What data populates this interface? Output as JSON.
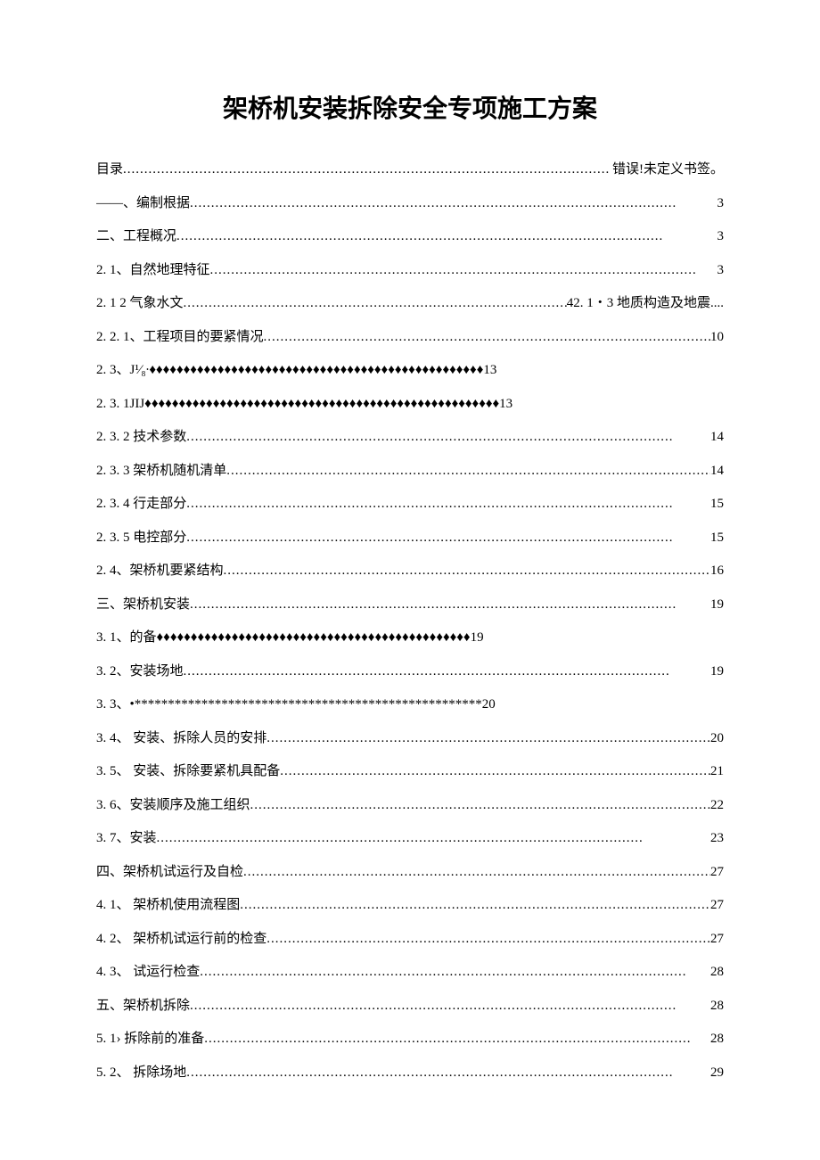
{
  "title": "架桥机安装拆除安全专项施工方案",
  "toc": [
    {
      "label": "目录",
      "style": "dots",
      "page": "错误!未定义书签。"
    },
    {
      "label": "——、编制根据",
      "style": "dots",
      "page": "3"
    },
    {
      "label": "二、工程概况",
      "style": "dots",
      "page": "3"
    },
    {
      "label": "2. 1、自然地理特征 ",
      "style": "dots",
      "page": "3"
    },
    {
      "label": "2. 1 2 气象水文",
      "style": "dots",
      "page": "42. 1・3 地质构造及地震...."
    },
    {
      "label": "2. 2. 1、工程项目的要紧情况 ",
      "style": "dots",
      "page": "10"
    },
    {
      "label": "2. 3、J¹⁄₈∙",
      "style": "diamonds",
      "fill": "♦♦♦♦♦♦♦♦♦♦♦♦♦♦♦♦♦♦♦♦♦♦♦♦♦♦♦♦♦♦♦♦♦♦♦♦♦♦♦♦♦♦♦♦♦♦♦♦♦",
      "page": "13"
    },
    {
      "label": "2. 3. 1JIJ",
      "style": "diamonds",
      "fill": "♦♦♦♦♦♦♦♦♦♦♦♦♦♦♦♦♦♦♦♦♦♦♦♦♦♦♦♦♦♦♦♦♦♦♦♦♦♦♦♦♦♦♦♦♦♦♦♦♦♦♦♦",
      "page": "13"
    },
    {
      "label": "2. 3. 2 技术参数",
      "style": "dots",
      "page": "14"
    },
    {
      "label": "2. 3. 3 架桥机随机清单",
      "style": "dots",
      "page": "14"
    },
    {
      "label": "2.  3. 4 行走部分",
      "style": "dots",
      "page": "15"
    },
    {
      "label": "2.  3. 5 电控部分",
      "style": "dots",
      "page": "15"
    },
    {
      "label": "2. 4、架桥机要紧结构",
      "style": "dots",
      "page": "16"
    },
    {
      "label": "三、架桥机安装",
      "style": "dots",
      "page": "19"
    },
    {
      "label": "3.  1、的备",
      "style": "diamonds",
      "fill": "♦♦♦♦♦♦♦♦♦♦♦♦♦♦♦♦♦♦♦♦♦♦♦♦♦♦♦♦♦♦♦♦♦♦♦♦♦♦♦♦♦♦♦♦♦♦",
      "page": "19"
    },
    {
      "label": "3.  2、安装场地 ",
      "style": "dots",
      "page": "19"
    },
    {
      "label": "3.  3、•",
      "style": "asterisks",
      "fill": "****************************************************",
      "page": "20"
    },
    {
      "label": "3. 4、 安装、拆除人员的安排",
      "style": "dots",
      "page": "20"
    },
    {
      "label": "3. 5、 安装、拆除要紧机具配备",
      "style": "dots",
      "page": "21"
    },
    {
      "label": "3. 6、安装顺序及施工组织 ",
      "style": "dots",
      "page": "22"
    },
    {
      "label": "3. 7、安装 ",
      "style": "dots",
      "page": "23"
    },
    {
      "label": "四、架桥机试运行及自检",
      "style": "dots",
      "page": "27"
    },
    {
      "label": "4. 1、 架桥机使用流程图",
      "style": "dots",
      "page": "27"
    },
    {
      "label": "4. 2、 架桥机试运行前的检查",
      "style": "dots",
      "page": "27"
    },
    {
      "label": "4. 3、 试运行检查",
      "style": "dots",
      "page": "28"
    },
    {
      "label": "五、架桥机拆除",
      "style": "dots",
      "page": "28"
    },
    {
      "label": "5. 1› 拆除前的准备 ",
      "style": "dots",
      "page": "28"
    },
    {
      "label": "5. 2、 拆除场地",
      "style": "dots",
      "page": "29"
    }
  ]
}
